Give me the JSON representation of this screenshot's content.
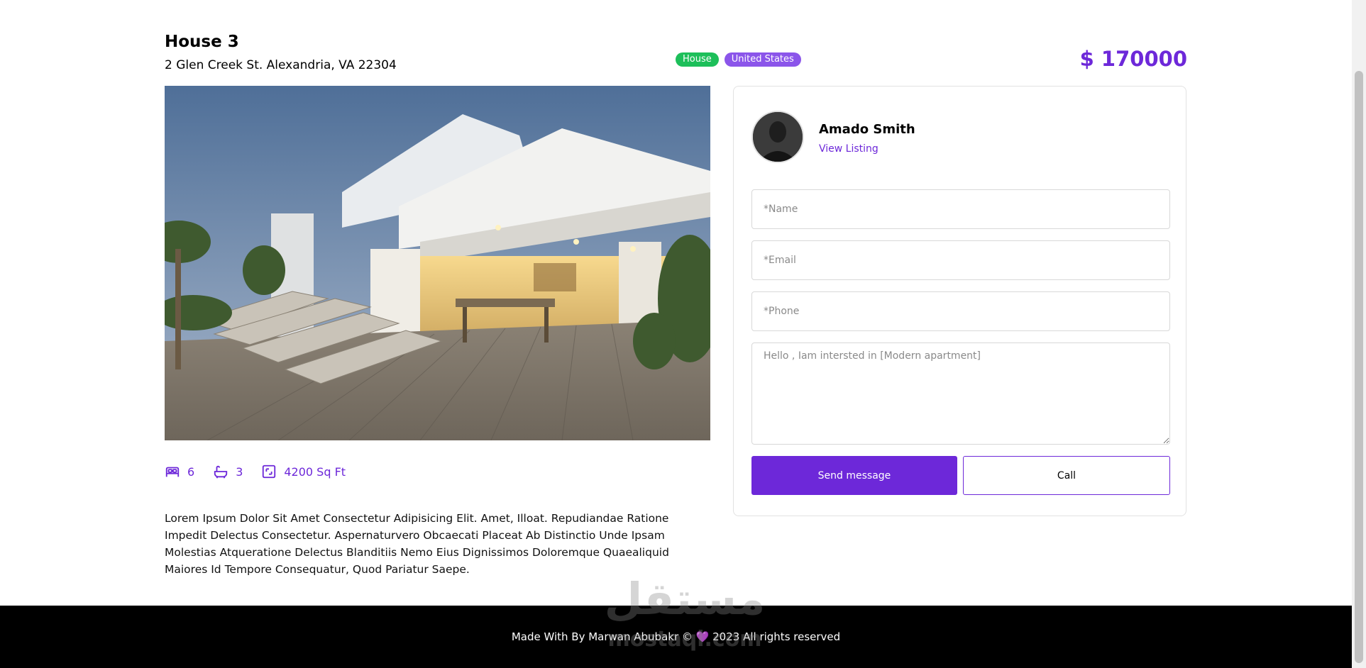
{
  "listing": {
    "title": "House 3",
    "address": "2 Glen Creek St. Alexandria, VA 22304",
    "badges": [
      "House",
      "United States"
    ],
    "price": "$ 170000",
    "photo_icon": "house-photo",
    "features": {
      "bedrooms": "6",
      "bathrooms": "3",
      "area": "4200 Sq Ft"
    },
    "description": "Lorem Ipsum Dolor Sit Amet Consectetur Adipisicing Elit. Amet, Illoat. Repudiandae Ratione Impedit Delectus Consectetur. Aspernaturvero Obcaecati Placeat Ab Distinctio Unde Ipsam Molestias Atqueratione Delectus Blanditiis Nemo Eius Dignissimos Doloremque Quaealiquid Maiores Id Tempore Consequatur, Quod Pariatur Saepe."
  },
  "agent": {
    "name": "Amado Smith",
    "link_label": "View Listing"
  },
  "form": {
    "name_placeholder": "*Name",
    "email_placeholder": "*Email",
    "phone_placeholder": "*Phone",
    "message_placeholder": "Hello , Iam intersted in [Modern apartment]",
    "send_label": "Send message",
    "call_label": "Call"
  },
  "footer": {
    "text_before": "Made With By Marwan Abubakr ©",
    "heart": "💜",
    "text_after": "2023 All rights reserved"
  },
  "watermark": {
    "arabic": "مستقل",
    "latin": "mostaql.com"
  },
  "colors": {
    "accent": "#6d28d9",
    "badge_house": "#1dbf5a",
    "badge_country": "#8b55ea",
    "footer_bg": "#000000"
  }
}
